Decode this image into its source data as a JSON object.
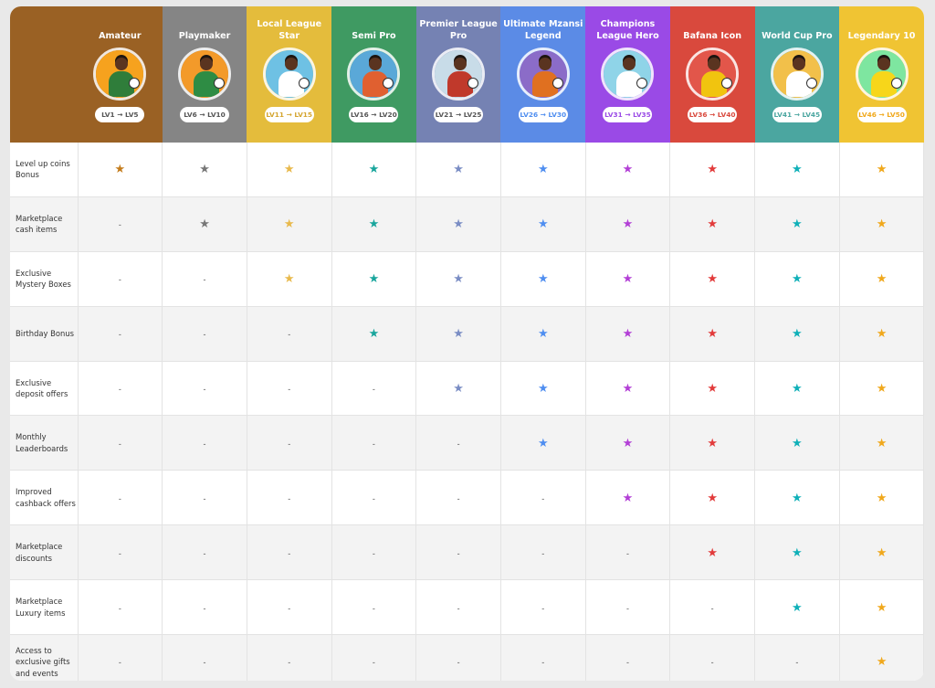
{
  "tiers": [
    {
      "name": "Amateur",
      "level": "LV1 → LV5",
      "color": "#9a6124",
      "star_color": "#c47c1c",
      "pill_color": "#555555",
      "avatar": {
        "bg": "#f6a21e",
        "shirt": "#2f7d3a"
      }
    },
    {
      "name": "Playmaker",
      "level": "LV6 → LV10",
      "color": "#858585",
      "star_color": "#777777",
      "pill_color": "#555555",
      "avatar": {
        "bg": "#f39a2a",
        "shirt": "#2e8c44"
      }
    },
    {
      "name": "Local League Star",
      "level": "LV11 → LV15",
      "color": "#e4bc3c",
      "star_color": "#e8b94c",
      "pill_color": "#d4a530",
      "avatar": {
        "bg": "#6ec1e4",
        "shirt": "#ffffff"
      }
    },
    {
      "name": "Semi Pro",
      "level": "LV16 → LV20",
      "color": "#3f9a62",
      "star_color": "#18a59c",
      "pill_color": "#555555",
      "avatar": {
        "bg": "#5aa8d8",
        "shirt": "#e06030"
      }
    },
    {
      "name": "Premier League Pro",
      "level": "LV21 → LV25",
      "color": "#7582b3",
      "star_color": "#7a8dc4",
      "pill_color": "#555555",
      "avatar": {
        "bg": "#c8dce8",
        "shirt": "#c0392b"
      }
    },
    {
      "name": "Ultimate Mzansi Legend",
      "level": "LV26 → LV30",
      "color": "#5b8be6",
      "star_color": "#4f8ef0",
      "pill_color": "#4f8ef0",
      "avatar": {
        "bg": "#8b6cc8",
        "shirt": "#e07020"
      }
    },
    {
      "name": "Champions League Hero",
      "level": "LV31 → LV35",
      "color": "#9a4ae6",
      "star_color": "#b23ed6",
      "pill_color": "#9a4ae6",
      "avatar": {
        "bg": "#8fd4e8",
        "shirt": "#ffffff"
      }
    },
    {
      "name": "Bafana Icon",
      "level": "LV36 → LV40",
      "color": "#d9493d",
      "star_color": "#e23b3b",
      "pill_color": "#d9493d",
      "avatar": {
        "bg": "#e2564a",
        "shirt": "#f1c40f"
      }
    },
    {
      "name": "World Cup Pro",
      "level": "LV41 → LV45",
      "color": "#4ba6a0",
      "star_color": "#0fb0b8",
      "pill_color": "#4ba6a0",
      "avatar": {
        "bg": "#f2c04a",
        "shirt": "#ffffff"
      }
    },
    {
      "name": "Legendary 10",
      "level": "LV46 → LV50",
      "color": "#f0c433",
      "star_color": "#f0a81c",
      "pill_color": "#f0a81c",
      "avatar": {
        "bg": "#7ee6a0",
        "shirt": "#f7d61a"
      }
    }
  ],
  "rows": [
    {
      "label": "Level up coins Bonus",
      "start": 0
    },
    {
      "label": "Marketplace cash items",
      "start": 1
    },
    {
      "label": "Exclusive Mystery Boxes",
      "start": 2
    },
    {
      "label": "Birthday Bonus",
      "start": 3
    },
    {
      "label": "Exclusive deposit offers",
      "start": 4
    },
    {
      "label": "Monthly Leaderboards",
      "start": 5
    },
    {
      "label": "Improved cashback offers",
      "start": 6
    },
    {
      "label": "Marketplace discounts",
      "start": 7
    },
    {
      "label": "Marketplace Luxury items",
      "start": 8
    },
    {
      "label": "Access to exclusive gifts and events",
      "start": 9
    }
  ],
  "symbols": {
    "included": "★",
    "not_included": "-"
  },
  "icons": {
    "included": "star-icon"
  }
}
